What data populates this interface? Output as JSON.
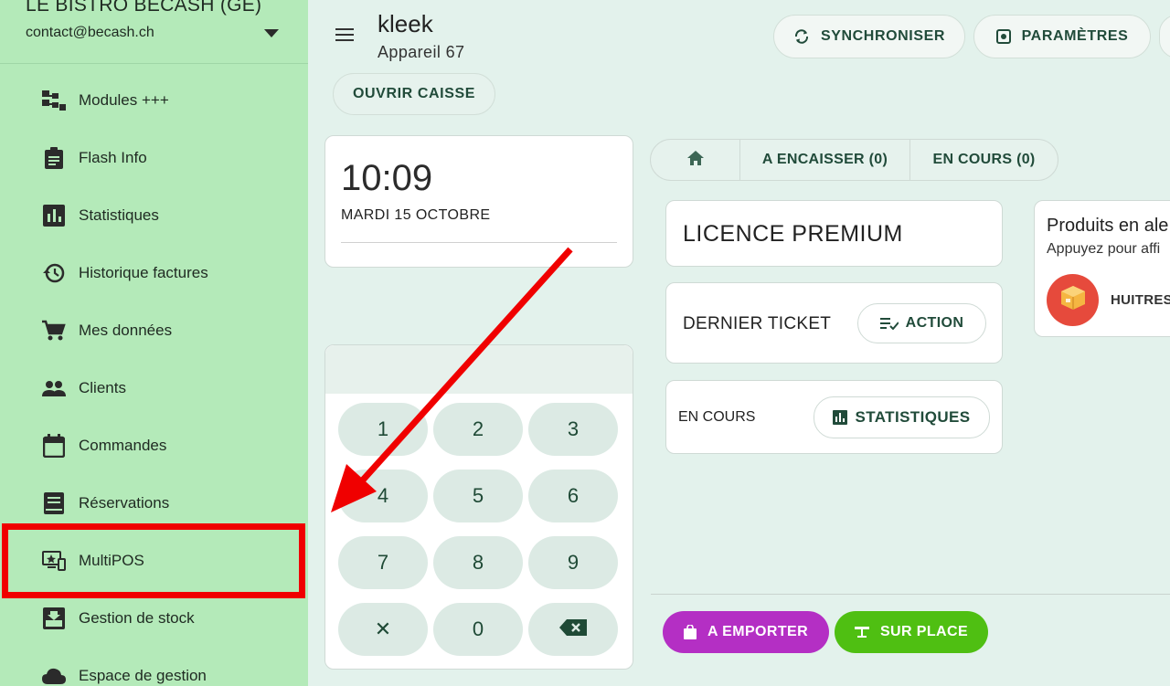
{
  "sidebar": {
    "account_name": "LE BISTRO BECASH (GE)",
    "email": "contact@becash.ch",
    "items": [
      {
        "label": "Modules +++",
        "icon": "modules-icon"
      },
      {
        "label": "Flash Info",
        "icon": "clipboard-icon"
      },
      {
        "label": "Statistiques",
        "icon": "bar-chart-icon"
      },
      {
        "label": "Historique factures",
        "icon": "history-icon"
      },
      {
        "label": "Mes données",
        "icon": "cart-icon"
      },
      {
        "label": "Clients",
        "icon": "people-icon"
      },
      {
        "label": "Commandes",
        "icon": "calendar-icon"
      },
      {
        "label": "Réservations",
        "icon": "book-icon"
      },
      {
        "label": "MultiPOS",
        "icon": "multipos-icon"
      },
      {
        "label": "Gestion de stock",
        "icon": "download-box-icon"
      },
      {
        "label": "Espace de gestion",
        "icon": "cloud-icon"
      }
    ]
  },
  "header": {
    "app_name": "kleek",
    "device": "Appareil 67",
    "sync_label": "SYNCHRONISER",
    "settings_label": "PARAMÈTRES",
    "open_register_label": "OUVRIR CAISSE"
  },
  "clock": {
    "time": "10:09",
    "date": "MARDI 15 OCTOBRE"
  },
  "keypad": {
    "keys": [
      "1",
      "2",
      "3",
      "4",
      "5",
      "6",
      "7",
      "8",
      "9",
      "✕",
      "0",
      "⌫"
    ]
  },
  "tabs": [
    {
      "label": "",
      "icon": "home-icon"
    },
    {
      "label": "A ENCAISSER (0)"
    },
    {
      "label": "EN COURS (0)"
    }
  ],
  "cards": {
    "license": "LICENCE PREMIUM",
    "last_ticket": "DERNIER TICKET",
    "action_label": "ACTION",
    "in_progress": "EN COURS",
    "stats_label": "STATISTIQUES"
  },
  "alert_panel": {
    "title": "Produits en ale",
    "subtitle": "Appuyez pour affi",
    "product": "HUITRES"
  },
  "actions": {
    "takeaway_label": "A EMPORTER",
    "dine_in_label": "SUR PLACE"
  },
  "colors": {
    "sidebar_bg": "#b4eab9",
    "highlight": "#f00000",
    "takeaway": "#b42fc4",
    "dine_in": "#4fbf12"
  }
}
